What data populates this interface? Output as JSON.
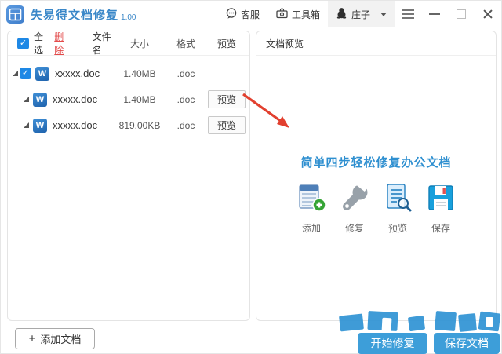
{
  "window": {
    "title": "失易得文档修复",
    "version": "1.00"
  },
  "titlebar": {
    "support_label": "客服",
    "toolbox_label": "工具箱",
    "username": "庄子",
    "icons": {
      "app": "app-logo",
      "support": "speech-bubble-icon",
      "toolbox": "toolbox-icon",
      "user": "penguin-avatar-icon",
      "dropdown": "caret-down-icon",
      "menu": "hamburger-icon",
      "minimize": "minimize-icon",
      "maximize": "maximize-icon",
      "close": "close-icon"
    }
  },
  "file_panel": {
    "header": {
      "select_all": "全选",
      "delete": "删除",
      "filename": "文件名",
      "size": "大小",
      "format": "格式",
      "preview": "预览"
    },
    "rows": [
      {
        "name": "xxxxx.doc",
        "size": "1.40MB",
        "format": ".doc",
        "preview_label": "",
        "checked": true,
        "level": 0
      },
      {
        "name": "xxxxx.doc",
        "size": "1.40MB",
        "format": ".doc",
        "preview_label": "预览",
        "checked": false,
        "level": 1
      },
      {
        "name": "xxxxx.doc",
        "size": "819.00KB",
        "format": ".doc",
        "preview_label": "预览",
        "checked": false,
        "level": 1
      }
    ]
  },
  "preview_panel": {
    "header": "文档预览",
    "headline": "简单四步轻松修复办公文档",
    "steps": [
      {
        "label": "添加",
        "icon": "add-table-icon"
      },
      {
        "label": "修复",
        "icon": "wrench-icon"
      },
      {
        "label": "预览",
        "icon": "document-magnifier-icon"
      },
      {
        "label": "保存",
        "icon": "floppy-disk-icon"
      }
    ]
  },
  "footer": {
    "add_button": "添加文档",
    "start_button": "开始修复",
    "save_button": "保存文档"
  },
  "colors": {
    "title_blue": "#3a87c8",
    "headline_blue": "#2e8fd0",
    "button_blue": "#3d9ed9",
    "checkbox_blue": "#1e88e5",
    "delete_red": "#e34b4b",
    "arrow_red": "#e2402f",
    "watermark_blue": "#2f93d4"
  }
}
